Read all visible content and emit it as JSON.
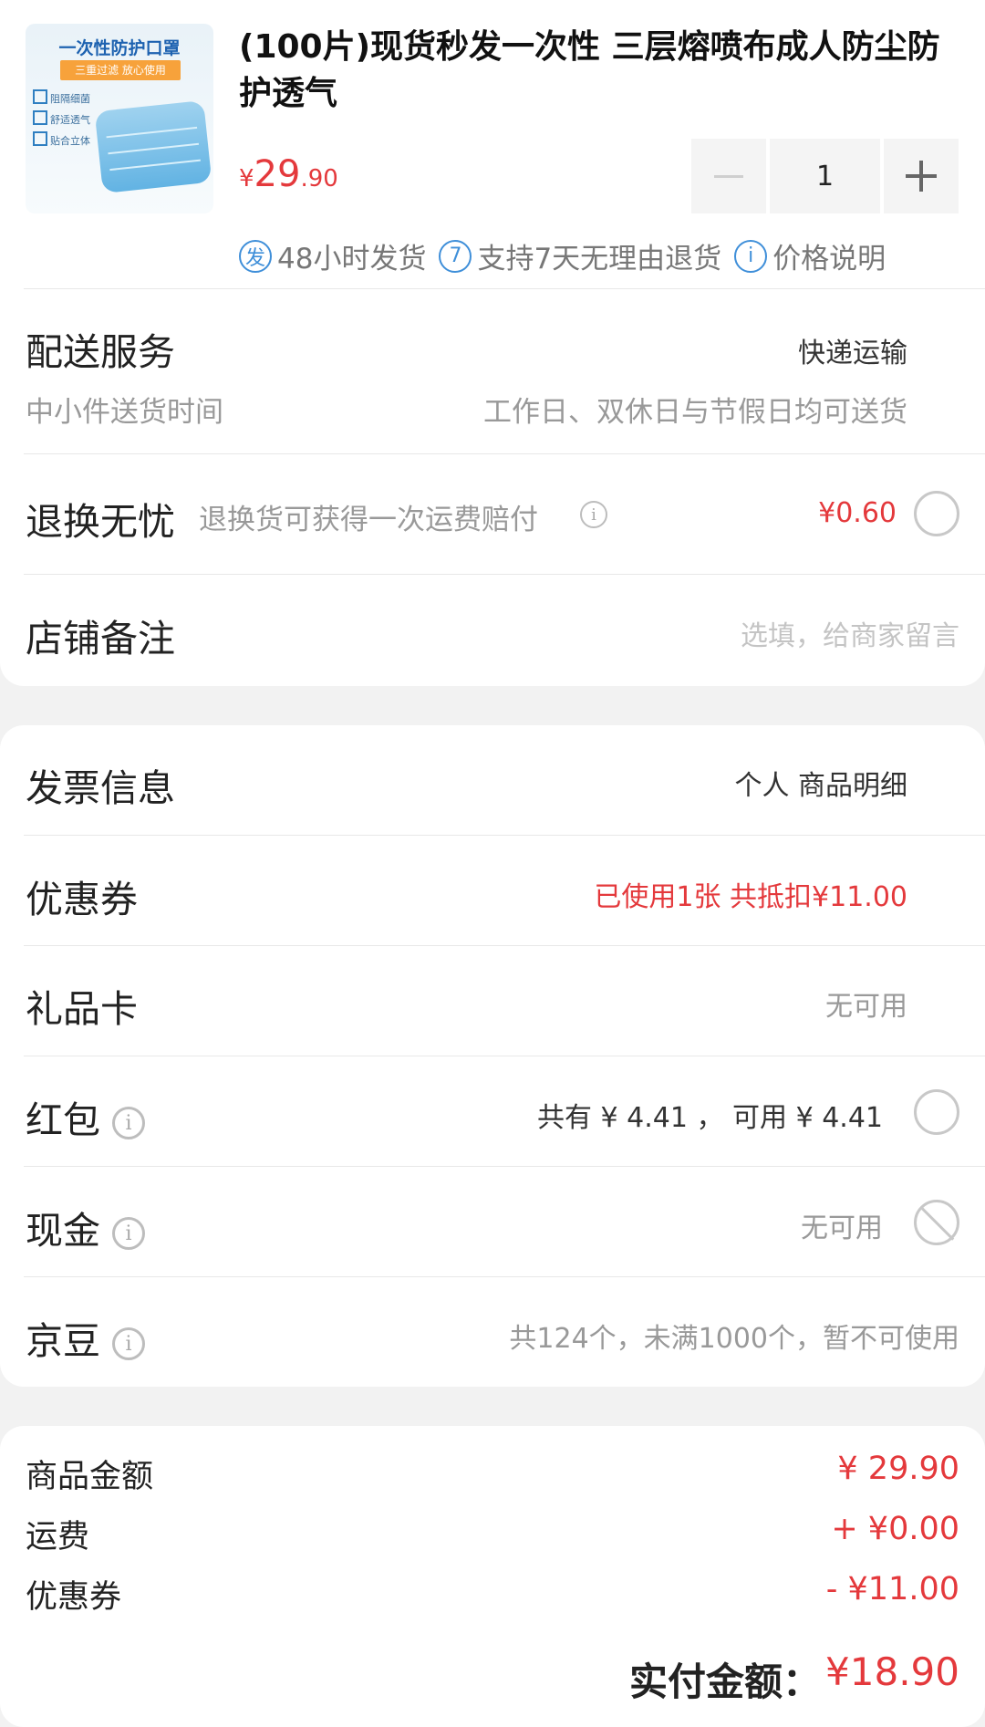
{
  "product": {
    "image_title": "一次性防护口罩",
    "image_banner": "三重过滤 放心使用",
    "image_features": [
      "阻隔细菌",
      "舒适透气",
      "贴合立体"
    ],
    "title": "(100片)现货秒发一次性 三层熔喷布成人防尘防护透气",
    "price_currency": "¥",
    "price_int": "29",
    "price_dec": ".90",
    "quantity": "1",
    "tags": [
      {
        "icon": "发",
        "label": "48小时发货"
      },
      {
        "icon": "7",
        "label": "支持7天无理由退货"
      },
      {
        "icon": "i",
        "label": "价格说明"
      }
    ]
  },
  "delivery": {
    "label": "配送服务",
    "value": "快递运输",
    "sub_label": "中小件送货时间",
    "sub_value": "工作日、双休日与节假日均可送货"
  },
  "return_insurance": {
    "label": "退换无忧",
    "desc": "退换货可获得一次运费赔付",
    "price": "¥0.60"
  },
  "note": {
    "label": "店铺备注",
    "placeholder": "选填，给商家留言"
  },
  "invoice": {
    "label": "发票信息",
    "value": "个人 商品明细"
  },
  "coupon": {
    "label": "优惠券",
    "value": "已使用1张 共抵扣¥11.00"
  },
  "gift_card": {
    "label": "礼品卡",
    "value": "无可用"
  },
  "red_packet": {
    "label": "红包",
    "value": "共有 ¥ 4.41 ， 可用 ¥ 4.41"
  },
  "cash": {
    "label": "现金",
    "value": "无可用"
  },
  "jingdou": {
    "label": "京豆",
    "value": "共124个，未满1000个，暂不可使用"
  },
  "summary": {
    "goods_label": "商品金额",
    "goods_value": "¥ 29.90",
    "shipping_label": "运费",
    "shipping_value": "+ ¥0.00",
    "coupon_label": "优惠券",
    "coupon_value": "- ¥11.00",
    "total_label": "实付金额：",
    "total_value": "¥18.90"
  },
  "colors": {
    "accent": "#e4393c",
    "info_blue": "#3f8fd9"
  }
}
